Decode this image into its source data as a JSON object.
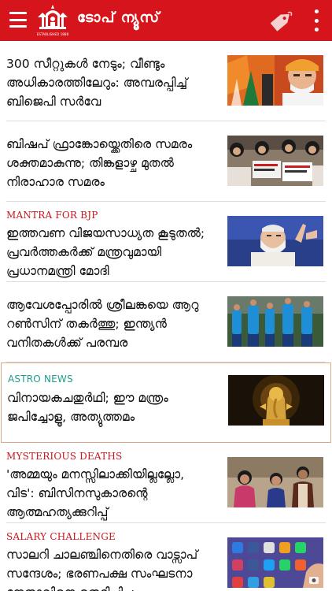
{
  "header": {
    "app_title": "ടോപ് ന്യൂസ്",
    "logo_caption": "ESTABLISHED 1888",
    "menu_icon": "hamburger-menu-icon",
    "tag_icon": "tag-icon",
    "more_icon": "more-vertical-icon",
    "bg_color": "#d5151b"
  },
  "feed": {
    "items": [
      {
        "kicker": "",
        "lines": [
          "300 സീറ്റുകൾ നേടും; വീണ്ടും",
          "അധികാരത്തിലേറും: അമ്പരപ്പിച്ച്",
          "ബിജെപി സർവേ"
        ]
      },
      {
        "kicker": "",
        "lines": [
          "ബിഷപ് ഫ്രാങ്കോയ്ക്കെതിരെ സമരം",
          "ശക്തമാകുന്നു; തിങ്കളാഴ്ച മുതൽ",
          "നിരാഹാര സമരം"
        ]
      },
      {
        "kicker": "MANTRA FOR BJP",
        "lines": [
          "ഇത്തവണ വിജയസാധ്യത കൂടുതൽ;",
          "പ്രവർത്തകർക്ക് മന്ത്രവുമായി",
          "പ്രധാനമന്ത്രി മോദി"
        ]
      },
      {
        "kicker": "",
        "lines": [
          "ആവേശപ്പോരിൽ ശ്രീലങ്കയെ ആറു",
          "റൺസിന് തകർത്തു; ഇന്ത്യൻ",
          "വനിതകൾക്ക് പരമ്പര"
        ]
      },
      {
        "kicker": "ASTRO NEWS",
        "lines": [
          "വിനായകചതുർഥി; ഈ മന്ത്രം",
          "ജപിച്ചോളൂ, അത്യുത്തമം"
        ]
      },
      {
        "kicker": "MYSTERIOUS DEATHS",
        "lines": [
          "'അമ്മയും മനസ്സിലാക്കിയില്ലല്ലോ,",
          "വിട': ബിസിനസുകാരന്റെ",
          "ആത്മഹത്യക്കുറിപ്പ്"
        ]
      },
      {
        "kicker": "SALARY CHALLENGE",
        "lines": [
          "സാലറി ചാലഞ്ചിനെതിരെ വാട്സാപ് ",
          "സന്ദേശം; ഭരണപക്ഷ സംഘടനാ",
          "നേതാവിനെ തെറിപ്പിച്ചു"
        ]
      }
    ]
  },
  "colors": {
    "kicker_red": "#c8161d",
    "kicker_teal": "#1e9b8f",
    "highlight_border": "#d9a98a"
  }
}
